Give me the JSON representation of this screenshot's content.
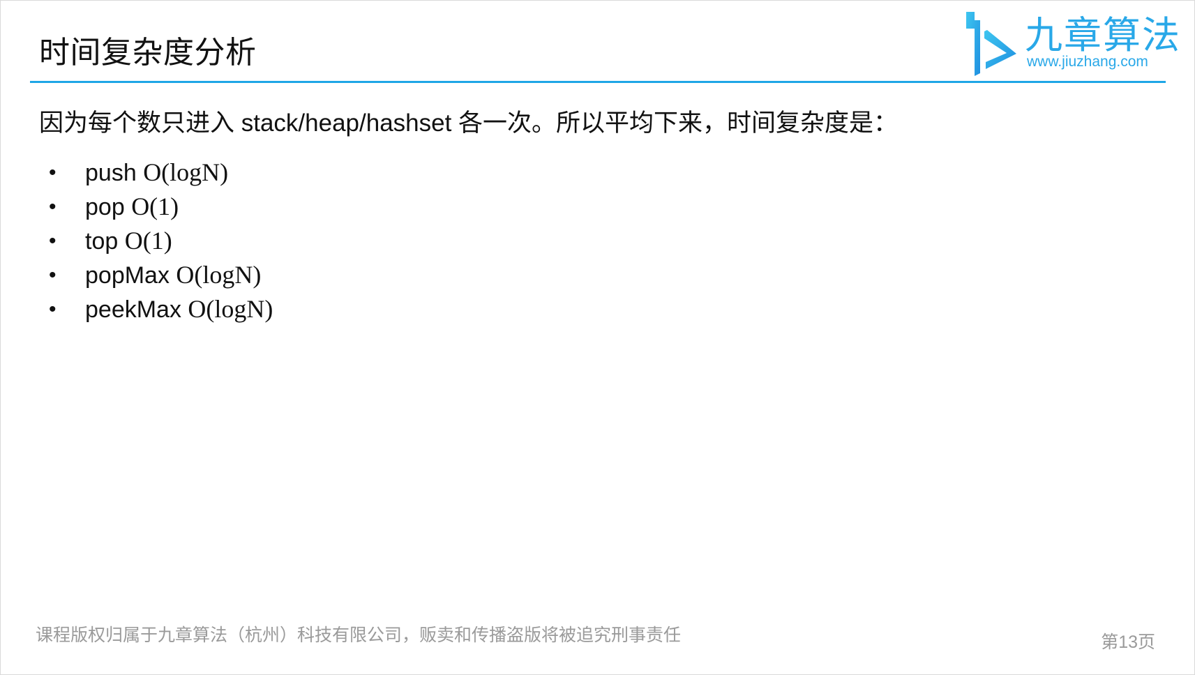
{
  "slide": {
    "title": "时间复杂度分析",
    "intro": "因为每个数只进入 stack/heap/hashset 各一次。所以平均下来，时间复杂度是：",
    "bullet_symbol": "•",
    "operations": [
      {
        "name": "push",
        "complexity": "O(logN)"
      },
      {
        "name": "pop",
        "complexity": "O(1)"
      },
      {
        "name": "top",
        "complexity": "O(1)"
      },
      {
        "name": "popMax",
        "complexity": "O(logN)"
      },
      {
        "name": "peekMax",
        "complexity": "O(logN)"
      }
    ]
  },
  "brand": {
    "name": "九章算法",
    "url": "www.jiuzhang.com",
    "logo_icon": "jiuzhang-logo-icon",
    "color": "#29a8e8"
  },
  "footer": {
    "copyright": "课程版权归属于九章算法（杭州）科技有限公司，贩卖和传播盗版将被追究刑事责任",
    "page_label": "第13页"
  },
  "colors": {
    "accent_rule": "#1ea6e6",
    "footer_text": "#9a9a9a",
    "body_text": "#111111"
  }
}
